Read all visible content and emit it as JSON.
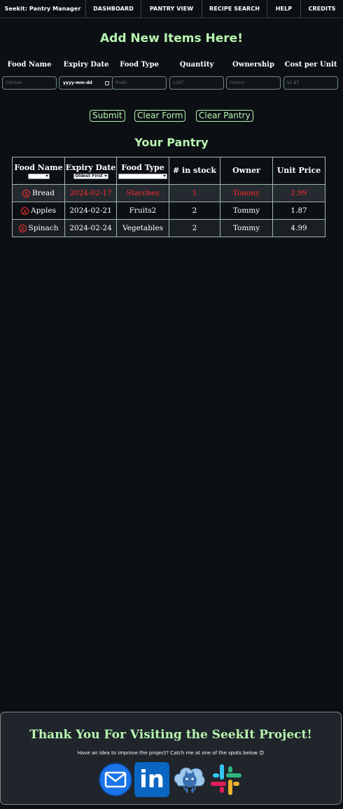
{
  "nav": {
    "items": [
      "Seekit: Pantry Manager",
      "DASHBOARD",
      "PANTRY VIEW",
      "RECIPE SEARCH",
      "HELP",
      "CREDITS"
    ]
  },
  "form": {
    "heading": "Add New Items Here!",
    "fields": [
      {
        "label": "Food Name",
        "placeholder": "Chicken"
      },
      {
        "label": "Expiry Date",
        "value": "yyyy-mm-dd"
      },
      {
        "label": "Food Type",
        "placeholder": "Fruits"
      },
      {
        "label": "Quantity",
        "placeholder": "1187"
      },
      {
        "label": "Ownership",
        "placeholder": "Connor"
      },
      {
        "label": "Cost per Unit",
        "placeholder": "$1.87"
      }
    ],
    "buttons": {
      "submit": "Submit",
      "clear_form": "Clear Form",
      "clear_pantry": "Clear Pantry"
    }
  },
  "pantry": {
    "heading": "Your Pantry",
    "columns": [
      "Food Name",
      "Expiry Date",
      "Food Type",
      "# in stock",
      "Owner",
      "Unit Price"
    ],
    "filters": {
      "food_name": "",
      "expiry_date": "Oldest First",
      "food_type": ""
    },
    "remove_glyph": "X",
    "rows": [
      {
        "name": "Bread",
        "expiry": "2024-02-17",
        "type": "Starches",
        "stock": "1",
        "owner": "Tommy",
        "price": "2.99",
        "expired": true
      },
      {
        "name": "Apples",
        "expiry": "2024-02-21",
        "type": "Fruits2",
        "stock": "2",
        "owner": "Tommy",
        "price": "1.87",
        "expired": false
      },
      {
        "name": "Spinach",
        "expiry": "2024-02-24",
        "type": "Vegetables",
        "stock": "2",
        "owner": "Tommy",
        "price": "4.99",
        "expired": false
      }
    ]
  },
  "footer": {
    "title": "Thank You For Visiting the SeekIt Project!",
    "subtitle": "Have an idea to improve the project? Catch me at one of the spots below 😊",
    "icons": [
      "mail-icon",
      "linkedin-icon",
      "github-icon",
      "slack-icon"
    ],
    "linkedin_text": "in"
  },
  "colors": {
    "accent_green": "#b8f5b0",
    "background": "#0c1014",
    "expired_red": "#ff2a2a",
    "linkedin_blue": "#0a66c2",
    "mail_blue": "#1a73e8"
  }
}
